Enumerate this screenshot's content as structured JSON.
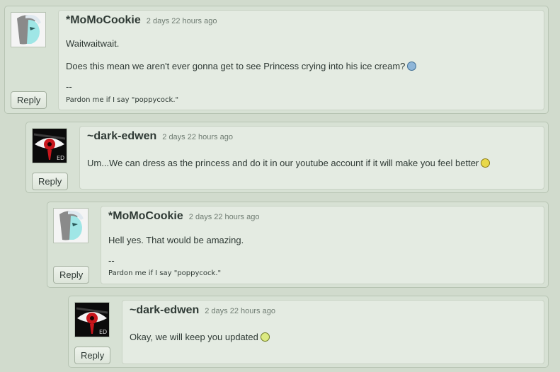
{
  "comments": [
    {
      "user": "*MoMoCookie",
      "time": "2 days 22 hours ago",
      "lines": [
        "Waitwaitwait.",
        "Does this mean we aren't ever gonna get to see Princess crying into his ice cream?"
      ],
      "sig_sep": "--",
      "signature": "Pardon me if I say \"poppycock.\"",
      "reply": "Reply"
    },
    {
      "user": "~dark-edwen",
      "time": "2 days 22 hours ago",
      "lines": [
        "Um...We can dress as the princess and do it in our youtube account if it will make you feel better"
      ],
      "reply": "Reply"
    },
    {
      "user": "*MoMoCookie",
      "time": "2 days 22 hours ago",
      "lines": [
        "Hell yes. That would be amazing."
      ],
      "sig_sep": "--",
      "signature": "Pardon me if I say \"poppycock.\"",
      "reply": "Reply"
    },
    {
      "user": "~dark-edwen",
      "time": "2 days 22 hours ago",
      "lines": [
        "Okay, we will keep you updated"
      ],
      "reply": "Reply"
    }
  ],
  "icons": {
    "avatar_momo": "anime-girl-avatar",
    "avatar_edwen": "red-eye-avatar",
    "emote_sad": "sad-face-emoticon",
    "emote_smile": "smile-emoticon",
    "emote_grin": "grin-emoticon"
  },
  "avatar_text": "ED"
}
